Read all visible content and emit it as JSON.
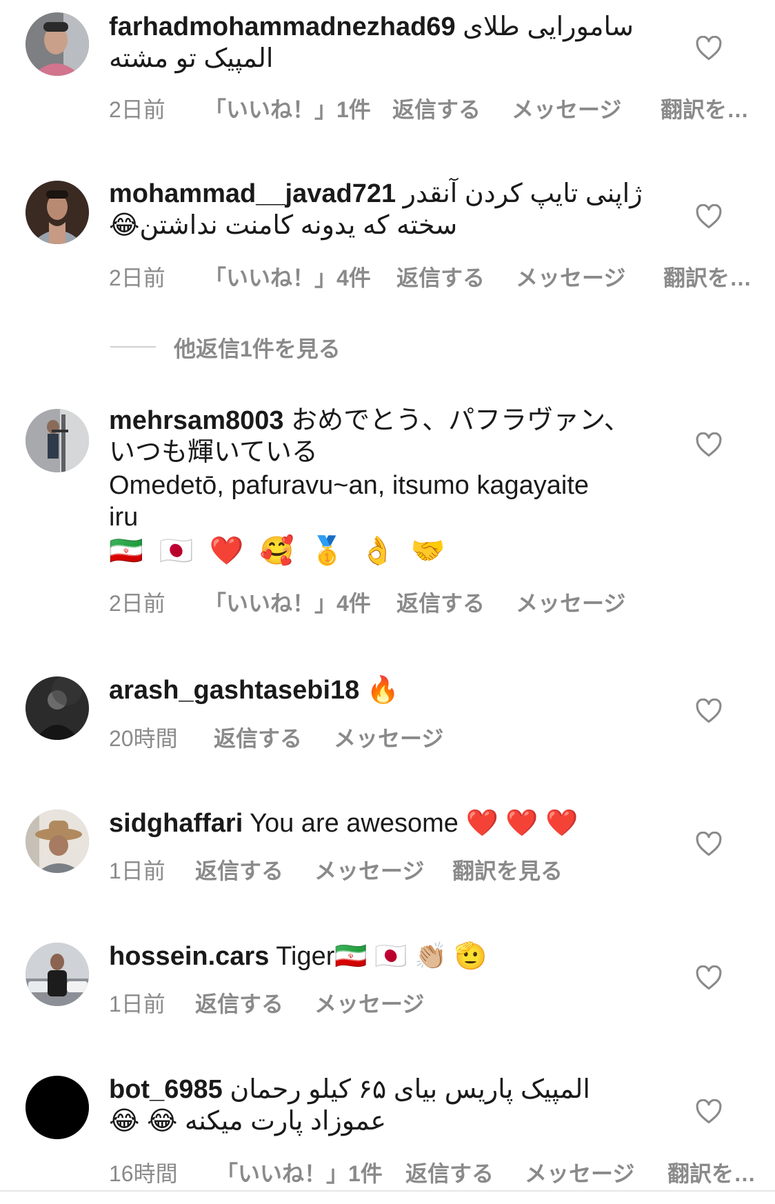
{
  "comments": [
    {
      "username": "farhadmohammadnezhad69",
      "text_line1": "سامورایی طلای",
      "text_line2": "المپیک تو مشته",
      "time": "2日前",
      "likes": "「いいね！」1件",
      "reply": "返信する",
      "message": "メッセージ",
      "translate": "翻訳を…"
    },
    {
      "username": "mohammad__javad721",
      "text_line1": "ژاپنی تایپ کردن آنقدر",
      "text_line2": "سخته که یدونه کامنت نداشتن😂",
      "time": "2日前",
      "likes": "「いいね！」4件",
      "reply": "返信する",
      "message": "メッセージ",
      "translate": "翻訳を…"
    },
    {
      "username": "mehrsam8003",
      "text_line1": "おめでとう、パフラヴァン、",
      "text_line2": "いつも輝いている",
      "text_line3": "Omedetō, pafuravu~an, itsumo kagayaite",
      "text_line4": "iru",
      "emojis": "🇮🇷 🇯🇵 ❤️ 🥰 🥇 👌 🤝",
      "time": "2日前",
      "likes": "「いいね！」4件",
      "reply": "返信する",
      "message": "メッセージ"
    },
    {
      "username": "arash_gashtasebi18",
      "text_line1": "🔥",
      "time": "20時間",
      "reply": "返信する",
      "message": "メッセージ"
    },
    {
      "username": "sidghaffari",
      "text_line1": "You are awesome ❤️ ❤️ ❤️",
      "time": "1日前",
      "reply": "返信する",
      "message": "メッセージ",
      "translate": "翻訳を見る"
    },
    {
      "username": "hossein.cars",
      "text_line1": "Tiger🇮🇷 🇯🇵 👏🏼 🫡",
      "time": "1日前",
      "reply": "返信する",
      "message": "メッセージ"
    },
    {
      "username": "bot_6985",
      "text_line1": "المپیک پاریس بیای ۶۵ کیلو رحمان",
      "text_line2": "عموزاد پارت میکنه 😂 😂",
      "time": "16時間",
      "likes": "「いいね！」1件",
      "reply": "返信する",
      "message": "メッセージ",
      "translate": "翻訳を…"
    }
  ],
  "more_replies": "他返信1件を見る",
  "icons": {
    "like": "heart-outline-icon"
  },
  "colors": {
    "text": "#1a1a1a",
    "meta": "#8a8a8a",
    "background": "#ffffff"
  }
}
